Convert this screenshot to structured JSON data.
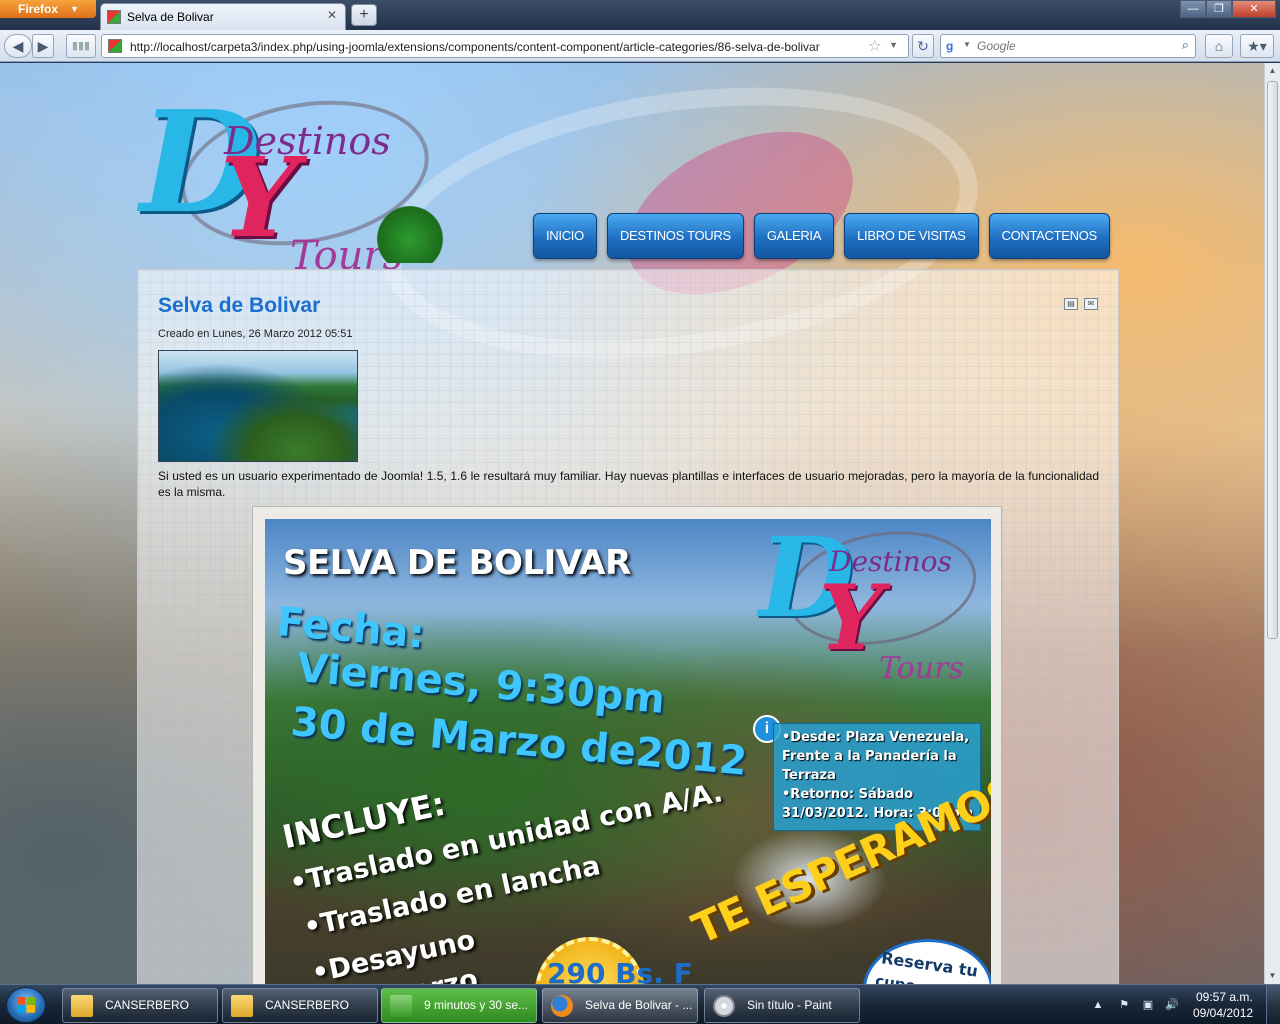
{
  "browser": {
    "app_button": "Firefox",
    "tab_title": "Selva de Bolivar",
    "url": "http://localhost/carpeta3/index.php/using-joomla/extensions/components/content-component/article-categories/86-selva-de-bolivar",
    "search_placeholder": "Google",
    "search_engine_icon": "google-icon"
  },
  "site": {
    "menu": [
      "INICIO",
      "DESTINOS TOURS",
      "GALERIA",
      "LIBRO DE VISITAS",
      "CONTACTENOS"
    ],
    "logo": {
      "big_d": "D",
      "big_y": "Y",
      "destinos": "Destinos",
      "tours": "Tours"
    }
  },
  "article": {
    "title": "Selva de Bolivar",
    "created": "Creado en Lunes, 26 Marzo 2012 05:51",
    "body": "Si usted es un usuario experimentado de Joomla! 1.5, 1.6 le resultará muy familiar. Hay nuevas plantillas e interfaces de usuario mejoradas, pero la mayoría de la funcionalidad es la misma.",
    "icons": [
      "print-icon",
      "email-icon"
    ]
  },
  "poster": {
    "heading": "SELVA DE BOLIVAR",
    "fecha_label": "Fecha:",
    "date_line1": "Viernes, 9:30pm",
    "date_line2": "30 de Marzo de2012",
    "info": [
      "•Desde: Plaza Venezuela,",
      "Frente a la Panadería  la",
      "Terraza",
      "•Retorno: Sábado",
      "31/03/2012. Hora: 3:00pm"
    ],
    "includes_label": "INCLUYE:",
    "includes": [
      "•Traslado en unidad con A/A.",
      "•Traslado en lancha",
      "•Desayuno",
      "•Almuerzo"
    ],
    "wait_text": "TE ESPERAMOS",
    "price_text": "290 Bs. F",
    "reserve_line1": "Reserva tu",
    "reserve_line2": "cupo con"
  },
  "taskbar": {
    "tasks": [
      {
        "label": "CANSERBERO",
        "icon": "folder-icon"
      },
      {
        "label": "CANSERBERO",
        "icon": "folder-icon"
      },
      {
        "label": "9 minutos y 30 se...",
        "icon": "transfer-icon"
      },
      {
        "label": "Selva de Bolivar - ...",
        "icon": "firefox-icon"
      },
      {
        "label": "Sin título - Paint",
        "icon": "paint-icon"
      }
    ],
    "clock_time": "09:57 a.m.",
    "clock_date": "09/04/2012"
  }
}
